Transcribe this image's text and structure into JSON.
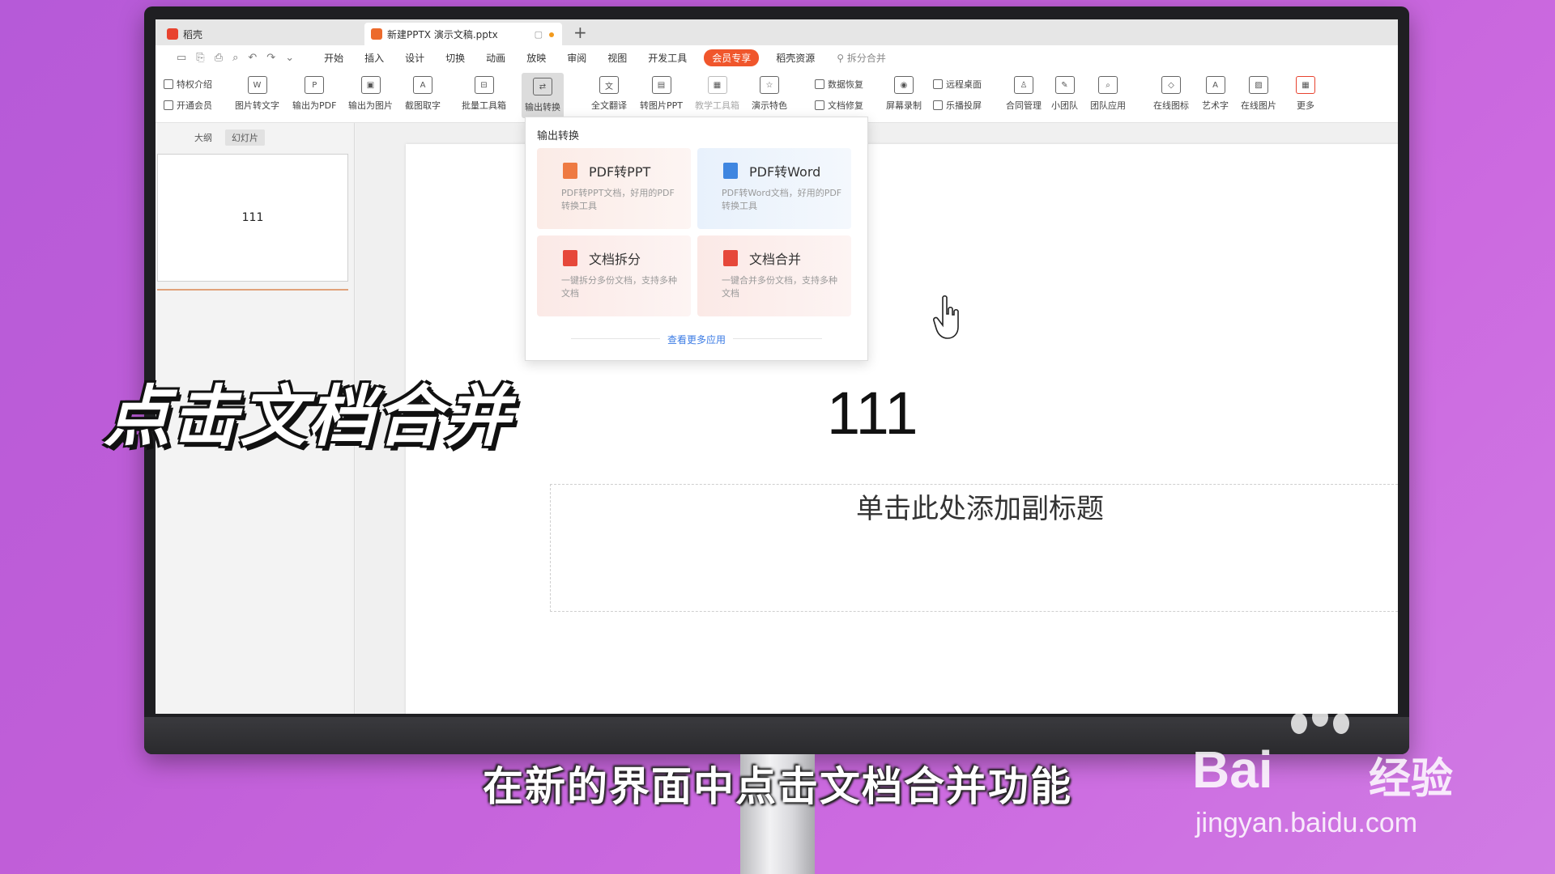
{
  "tabs": {
    "home_label": "稻壳",
    "doc_label": "新建PPTX 演示文稿.pptx"
  },
  "menu": {
    "items": [
      "开始",
      "插入",
      "设计",
      "切换",
      "动画",
      "放映",
      "审阅",
      "视图",
      "开发工具"
    ],
    "vip": "会员专享",
    "resources": "稻壳资源",
    "search": "拆分合并"
  },
  "ribbon": {
    "privilege": "特权介绍",
    "open_vip": "开通会员",
    "img_to_text": "图片转文字",
    "export_pdf": "输出为PDF",
    "export_img": "输出为图片",
    "screenshot_text": "截图取字",
    "batch_tools": "批量工具箱",
    "export_convert": "输出转换",
    "translate": "全文翻译",
    "to_img_ppt": "转图片PPT",
    "teach_tools": "教学工具箱",
    "present_feature": "演示特色",
    "data_recovery": "数据恢复",
    "doc_repair": "文档修复",
    "screen_record": "屏幕录制",
    "remote_desktop": "远程桌面",
    "cast": "乐播投屏",
    "contract": "合同管理",
    "small_team": "小团队",
    "team_apps": "团队应用",
    "online_icons": "在线图标",
    "art_text": "艺术字",
    "online_images": "在线图片",
    "more": "更多"
  },
  "left_panel": {
    "outline_tab": "大纲",
    "slides_tab": "幻灯片",
    "thumb_text": "111"
  },
  "slide": {
    "title": "111",
    "subtitle": "单击此处添加副标题"
  },
  "dropdown": {
    "title": "输出转换",
    "cards": [
      {
        "name": "PDF转PPT",
        "desc": "PDF转PPT文档，好用的PDF转换工具"
      },
      {
        "name": "PDF转Word",
        "desc": "PDF转Word文档，好用的PDF转换工具"
      },
      {
        "name": "文档拆分",
        "desc": "一键拆分多份文档，支持多种文档"
      },
      {
        "name": "文档合并",
        "desc": "一键合并多份文档，支持多种文档"
      }
    ],
    "more": "查看更多应用"
  },
  "overlay": {
    "action": "点击文档合并",
    "subtitle": "在新的界面中点击文档合并功能"
  },
  "watermark": {
    "logo": "Bai",
    "logo_tail": "经验",
    "url": "jingyan.baidu.com"
  }
}
